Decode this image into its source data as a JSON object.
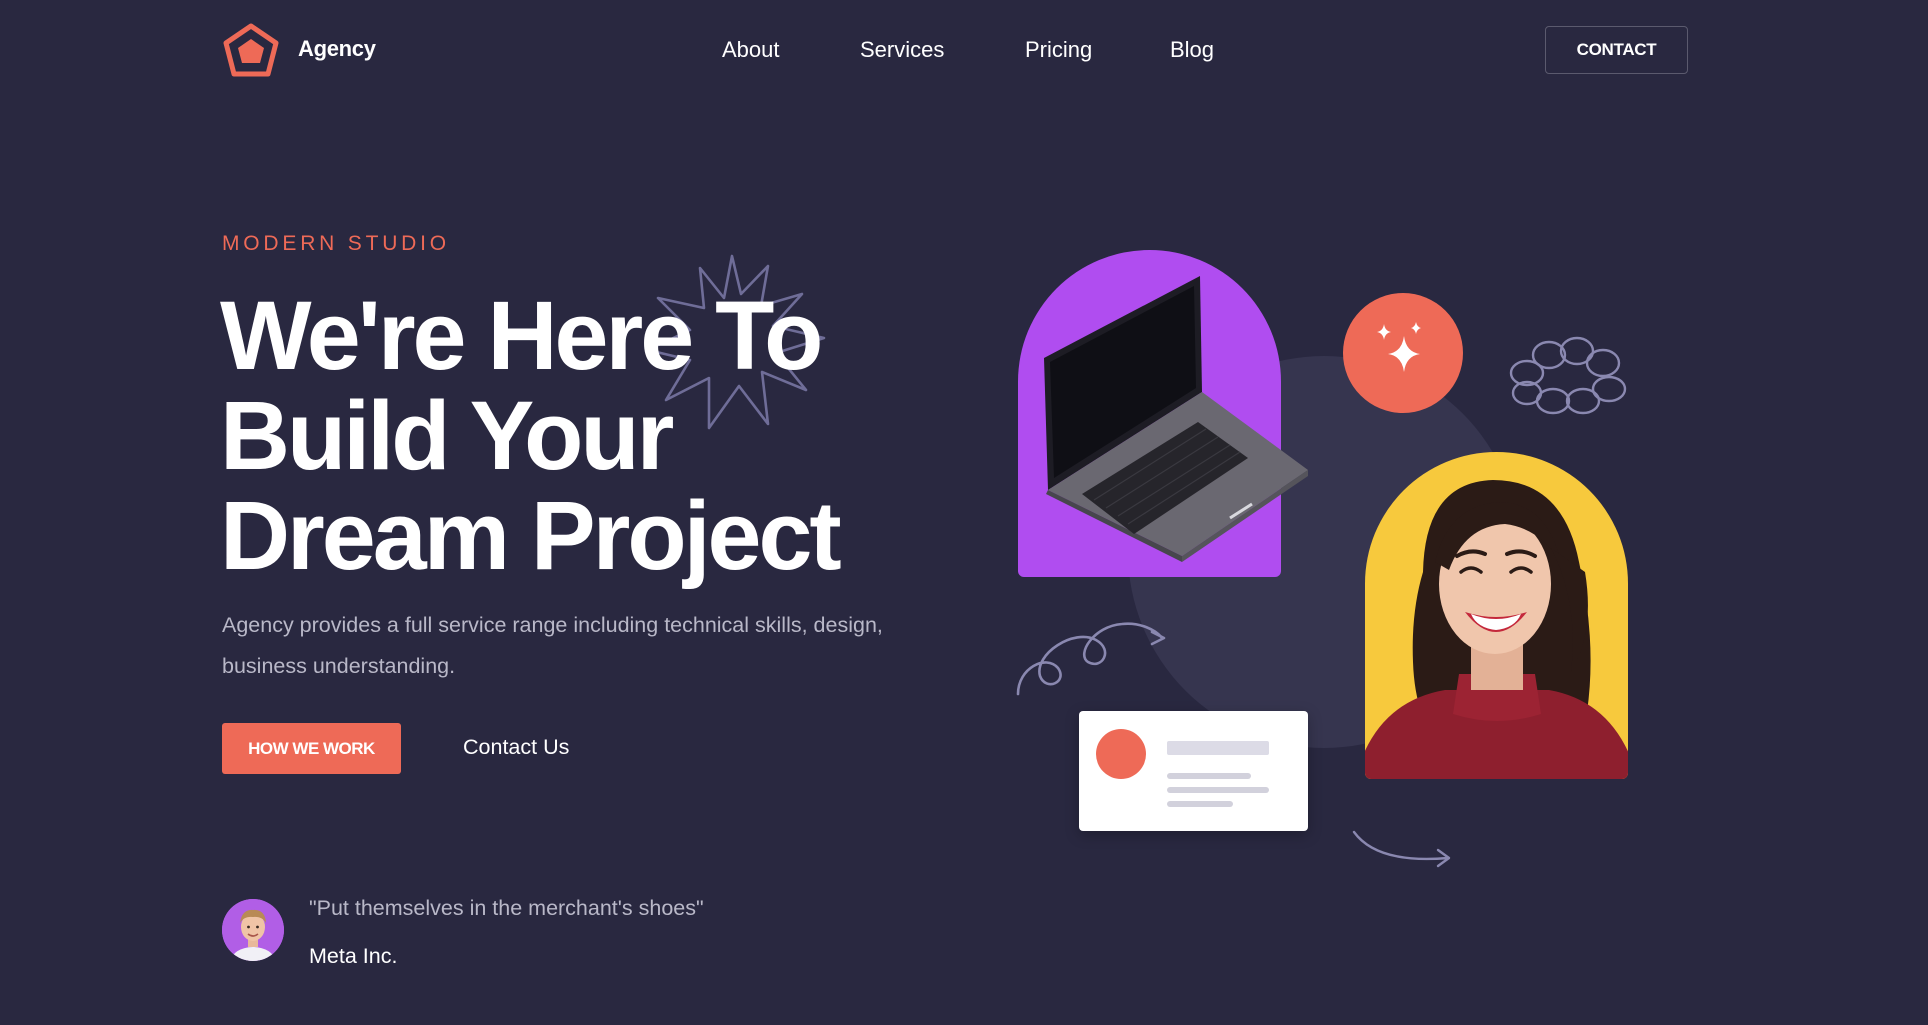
{
  "header": {
    "brand": "Agency",
    "logo_icon": "pentagon-logo-icon",
    "nav": [
      {
        "label": "About"
      },
      {
        "label": "Services"
      },
      {
        "label": "Pricing"
      },
      {
        "label": "Blog"
      }
    ],
    "contact_label": "CONTACT"
  },
  "hero": {
    "eyebrow": "MODERN STUDIO",
    "headline": [
      "We're Here To",
      "Build Your",
      "Dream Project"
    ],
    "description": "Agency provides a full service range including technical skills, design, business understanding.",
    "primary_button": "HOW WE WORK",
    "secondary_link": "Contact Us"
  },
  "testimonial": {
    "quote": "\"Put themselves in the merchant's shoes\"",
    "company": "Meta Inc."
  },
  "colors": {
    "background": "#292840",
    "accent": "#ee6a57",
    "purple": "#b04df0",
    "yellow": "#f7c93d"
  },
  "illustration": {
    "icons": [
      "star-burst-icon",
      "laptop-icon",
      "sparkle-icon",
      "cloud-doodle-icon",
      "swirl-doodle-icon",
      "arrow-doodle-icon",
      "profile-card-icon"
    ]
  }
}
